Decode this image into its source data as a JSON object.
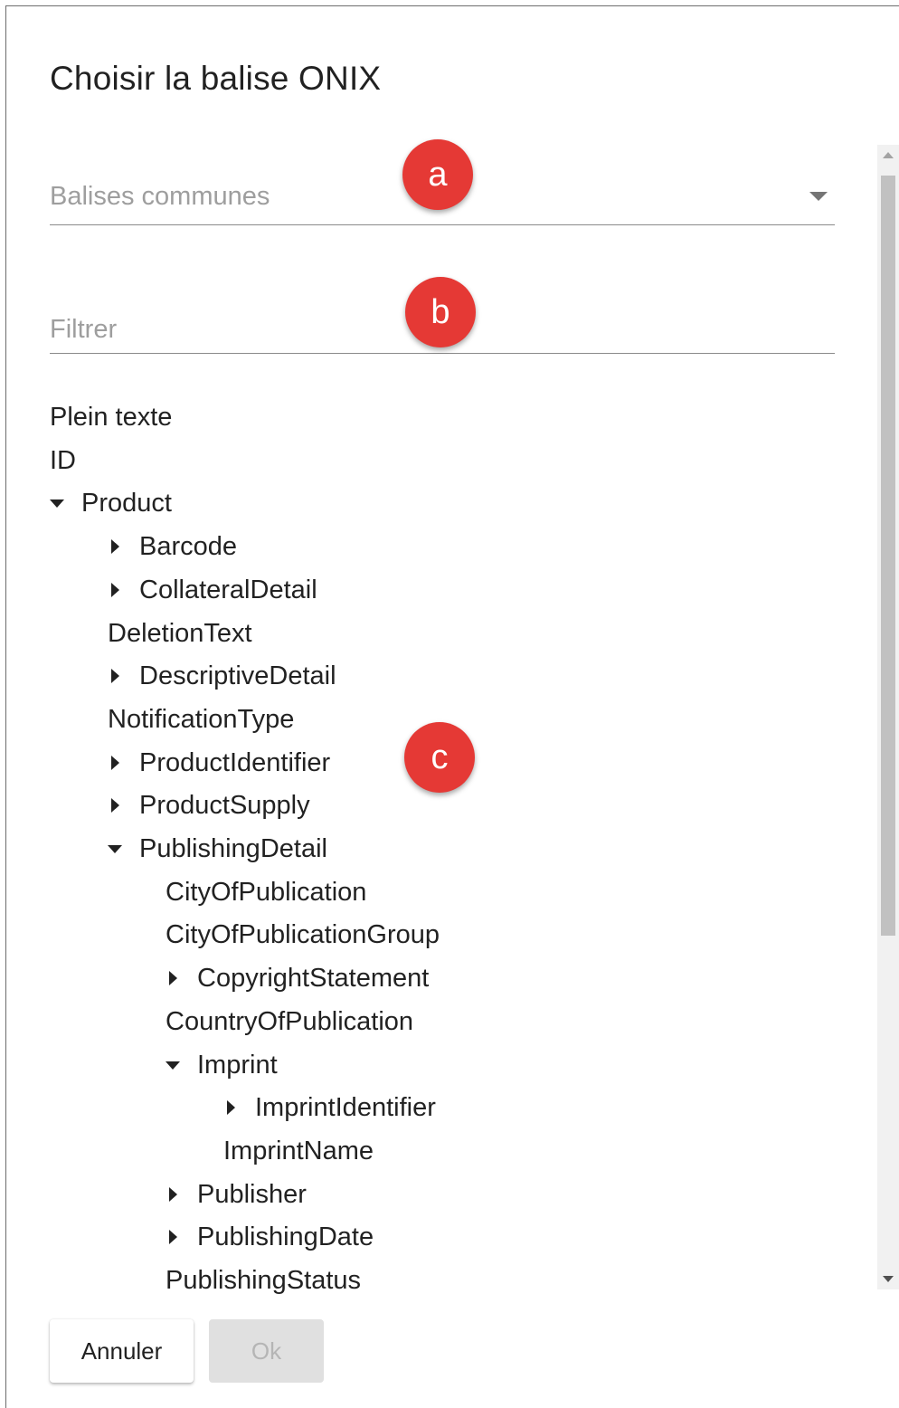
{
  "dialog": {
    "title": "Choisir la balise ONIX",
    "select": {
      "placeholder": "Balises communes"
    },
    "filter": {
      "placeholder": "Filtrer"
    },
    "badges": {
      "a": "a",
      "b": "b",
      "c": "c"
    },
    "tree": [
      {
        "label": "Plein texte",
        "state": "leaf",
        "level": 0
      },
      {
        "label": "ID",
        "state": "leaf",
        "level": 0
      },
      {
        "label": "Product",
        "state": "expanded",
        "level": 0
      },
      {
        "label": "Barcode",
        "state": "collapsed",
        "level": 1
      },
      {
        "label": "CollateralDetail",
        "state": "collapsed",
        "level": 1
      },
      {
        "label": "DeletionText",
        "state": "leaf",
        "level": 1
      },
      {
        "label": "DescriptiveDetail",
        "state": "collapsed",
        "level": 1
      },
      {
        "label": "NotificationType",
        "state": "leaf",
        "level": 1
      },
      {
        "label": "ProductIdentifier",
        "state": "collapsed",
        "level": 1
      },
      {
        "label": "ProductSupply",
        "state": "collapsed",
        "level": 1
      },
      {
        "label": "PublishingDetail",
        "state": "expanded",
        "level": 1
      },
      {
        "label": "CityOfPublication",
        "state": "leaf",
        "level": 2
      },
      {
        "label": "CityOfPublicationGroup",
        "state": "leaf",
        "level": 2
      },
      {
        "label": "CopyrightStatement",
        "state": "collapsed",
        "level": 2
      },
      {
        "label": "CountryOfPublication",
        "state": "leaf",
        "level": 2
      },
      {
        "label": "Imprint",
        "state": "expanded",
        "level": 2
      },
      {
        "label": "ImprintIdentifier",
        "state": "collapsed",
        "level": 3
      },
      {
        "label": "ImprintName",
        "state": "leaf",
        "level": 3
      },
      {
        "label": "Publisher",
        "state": "collapsed",
        "level": 2
      },
      {
        "label": "PublishingDate",
        "state": "collapsed",
        "level": 2
      },
      {
        "label": "PublishingStatus",
        "state": "leaf",
        "level": 2
      }
    ],
    "buttons": {
      "cancel": "Annuler",
      "ok": "Ok"
    }
  }
}
